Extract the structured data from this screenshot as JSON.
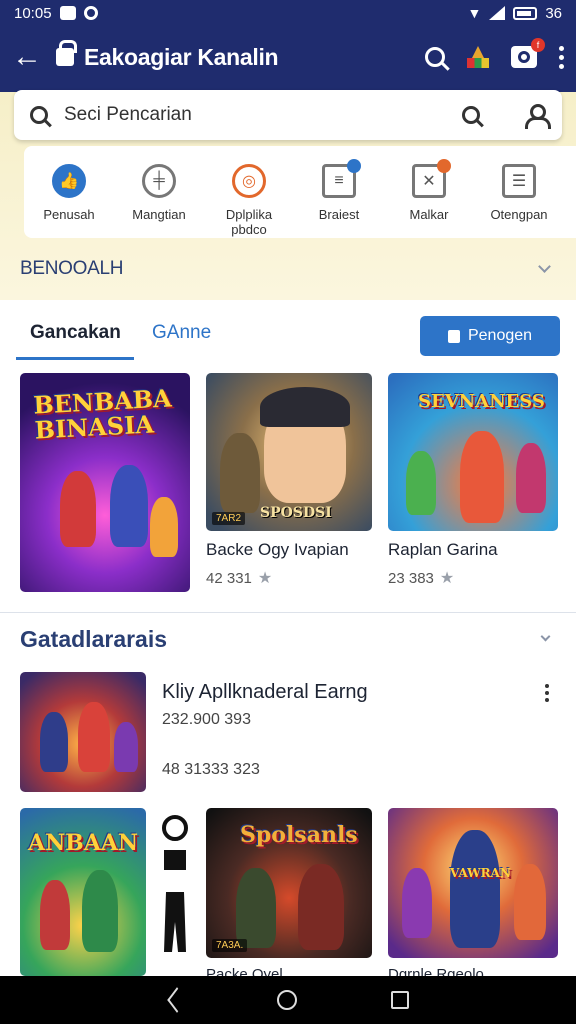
{
  "status_bar": {
    "time": "10:05",
    "battery": "36"
  },
  "app_bar": {
    "title": "Eakoagiar Kanalin",
    "notification_badge": "f"
  },
  "search": {
    "placeholder": "Seci Pencarian"
  },
  "categories": [
    {
      "label": "Penusah",
      "icon": "thumbs-up-icon"
    },
    {
      "label": "Mangtian",
      "icon": "dumbbell-icon"
    },
    {
      "label": "Dplplika\npbdco",
      "icon": "target-icon"
    },
    {
      "label": "Braiest",
      "icon": "chat-icon"
    },
    {
      "label": "Malkar",
      "icon": "mail-icon"
    },
    {
      "label": "Otengpan",
      "icon": "list-icon"
    }
  ],
  "section_header": "BENOOALH",
  "tabs": {
    "active": "Gancakan",
    "inactive": "GAnne"
  },
  "cta_button": {
    "label": "Penogen"
  },
  "featured": [
    {
      "art_title": "BENBABA\nBINASIA",
      "name": "",
      "meta": ""
    },
    {
      "art_title": "SPOSDSI",
      "price_chip": "7AR2",
      "name": "Backe Ogy Ivapian",
      "meta": "42 331"
    },
    {
      "art_title": "SEVNANESS",
      "name": "Raplan Garina",
      "meta": "23 383"
    }
  ],
  "section2": {
    "title": "Gatadlararais"
  },
  "list_item": {
    "title": "Kliy Apllknaderal Earng",
    "line1": "232.900 393",
    "line2": "48 31333 323"
  },
  "bottom_cards": [
    {
      "art_title": "ANBAAN"
    },
    {
      "art_title": "Spolsanls",
      "price_chip": "7A3A.",
      "name": "Packe Oyel..."
    },
    {
      "art_title": "VAWRAN",
      "name": "Dgrnle Rgeolo"
    }
  ],
  "colors": {
    "appbar": "#1f2c6e",
    "accent": "#2d74c8",
    "section_header": "#2a3f73"
  }
}
